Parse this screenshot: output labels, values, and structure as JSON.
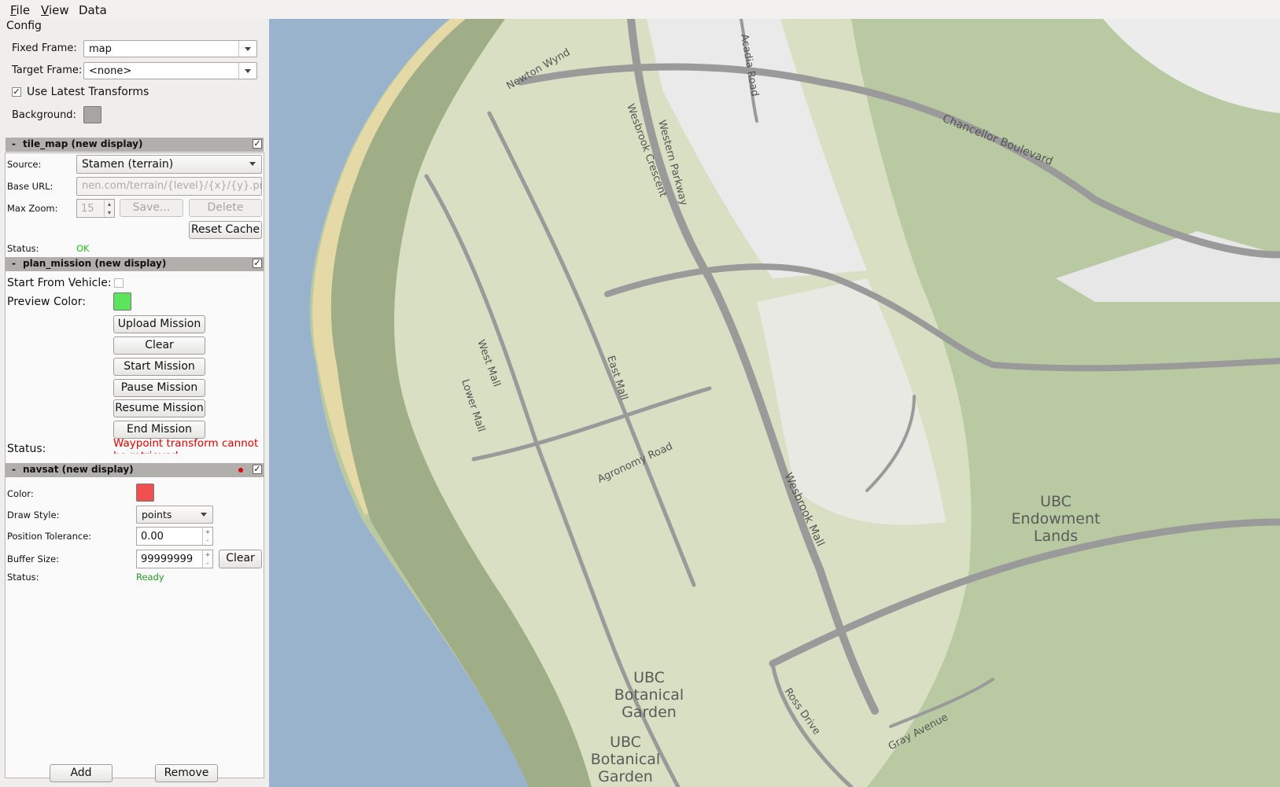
{
  "menu": {
    "file": "File",
    "view": "View",
    "data": "Data"
  },
  "config": {
    "title": "Config",
    "fixed_frame_label": "Fixed Frame:",
    "fixed_frame_value": "map",
    "target_frame_label": "Target Frame:",
    "target_frame_value": "<none>",
    "use_latest_label": "Use Latest Transforms",
    "use_latest_checked": "✓",
    "background_label": "Background:"
  },
  "tile_map": {
    "header": "tile_map (new display)",
    "toggle": "-",
    "check": "✓",
    "source_label": "Source:",
    "source_value": "Stamen (terrain)",
    "base_url_label": "Base URL:",
    "base_url_value": "nen.com/terrain/{level}/{x}/{y}.png",
    "max_zoom_label": "Max Zoom:",
    "max_zoom_value": "15",
    "save_label": "Save...",
    "delete_label": "Delete",
    "reset_cache_label": "Reset Cache",
    "status_label": "Status:",
    "status_value": "OK",
    "status_color": "#22c322"
  },
  "plan_mission": {
    "header": "plan_mission (new display)",
    "toggle": "-",
    "check": "✓",
    "start_from_vehicle_label": "Start From Vehicle:",
    "preview_color_label": "Preview Color:",
    "preview_color": "#5ce55c",
    "buttons": [
      "Upload Mission",
      "Clear",
      "Start Mission",
      "Pause Mission",
      "Resume Mission",
      "End Mission"
    ],
    "status_label": "Status:",
    "status_value": "Waypoint transform cannot be retrieved",
    "status_color": "#e00000"
  },
  "navsat": {
    "header": "navsat (new display)",
    "toggle": "-",
    "check": "✓",
    "color_label": "Color:",
    "color": "#f05050",
    "draw_style_label": "Draw Style:",
    "draw_style_value": "points",
    "position_tolerance_label": "Position Tolerance:",
    "position_tolerance_value": "0.00",
    "buffer_size_label": "Buffer Size:",
    "buffer_size_value": "99999999",
    "clear_label": "Clear",
    "status_label": "Status:",
    "status_value": "Ready",
    "status_color": "#2a9a2a"
  },
  "footer": {
    "add_label": "Add",
    "remove_label": "Remove"
  },
  "map": {
    "labels": {
      "newton_wynd": "Newton Wynd",
      "acadia_road": "Acadia Road",
      "wesbrook_crescent": "Wesbrook Crescent",
      "western_parkway": "Western Parkway",
      "chancellor_boulevard": "Chancellor Boulevard",
      "west_mall": "West Mall",
      "lower_mall": "Lower Mall",
      "east_mall": "East Mall",
      "agronomy_road": "Agronomy Road",
      "wesbrook_mall": "Wesbrook Mall",
      "ubc_endowment_lands": [
        "UBC",
        "Endowment",
        "Lands"
      ],
      "ubc_botanical_garden_1": [
        "UBC",
        "Botanical",
        "Garden"
      ],
      "ubc_botanical_garden_2": [
        "UBC",
        "Botanical",
        "Garden"
      ],
      "ross_drive": "Ross Drive",
      "gray_avenue": "Gray Avenue"
    },
    "colors": {
      "water": "#9ab3cc",
      "forest": "#b9caa2",
      "campus": "#d9dfc2",
      "road": "#9a9a9a"
    }
  }
}
